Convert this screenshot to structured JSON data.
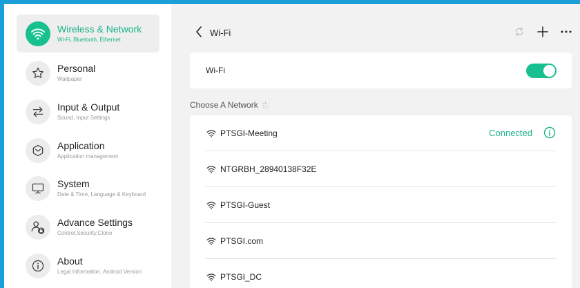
{
  "sidebar": {
    "items": [
      {
        "label": "Wireless & Network",
        "sub": "Wi-Fi, Bluetooth, Ethernet",
        "icon": "wifi-icon"
      },
      {
        "label": "Personal",
        "sub": "Wallpaper",
        "icon": "star-icon"
      },
      {
        "label": "Input & Output",
        "sub": "Sound, Input Settings",
        "icon": "arrows-swap-icon"
      },
      {
        "label": "Application",
        "sub": "Application management",
        "icon": "cube-icon"
      },
      {
        "label": "System",
        "sub": "Date & Time, Language & Keyboard",
        "icon": "monitor-icon"
      },
      {
        "label": "Advance Settings",
        "sub": "Control,Security,Clone",
        "icon": "user-lock-icon"
      },
      {
        "label": "About",
        "sub": "Legal Information, Android Version",
        "icon": "info-icon"
      }
    ]
  },
  "header": {
    "title": "Wi-Fi"
  },
  "wifi_toggle": {
    "label": "Wi-Fi",
    "state": "on"
  },
  "networks": {
    "heading": "Choose A Network",
    "items": [
      {
        "name": "PTSGI-Meeting",
        "status": "Connected"
      },
      {
        "name": "NTGRBH_28940138F32E",
        "status": ""
      },
      {
        "name": "PTSGI-Guest",
        "status": ""
      },
      {
        "name": "PTSGI.com",
        "status": ""
      },
      {
        "name": "PTSGI_DC",
        "status": ""
      }
    ]
  },
  "colors": {
    "accent": "#18c08f",
    "frame": "#1c9fd8"
  }
}
